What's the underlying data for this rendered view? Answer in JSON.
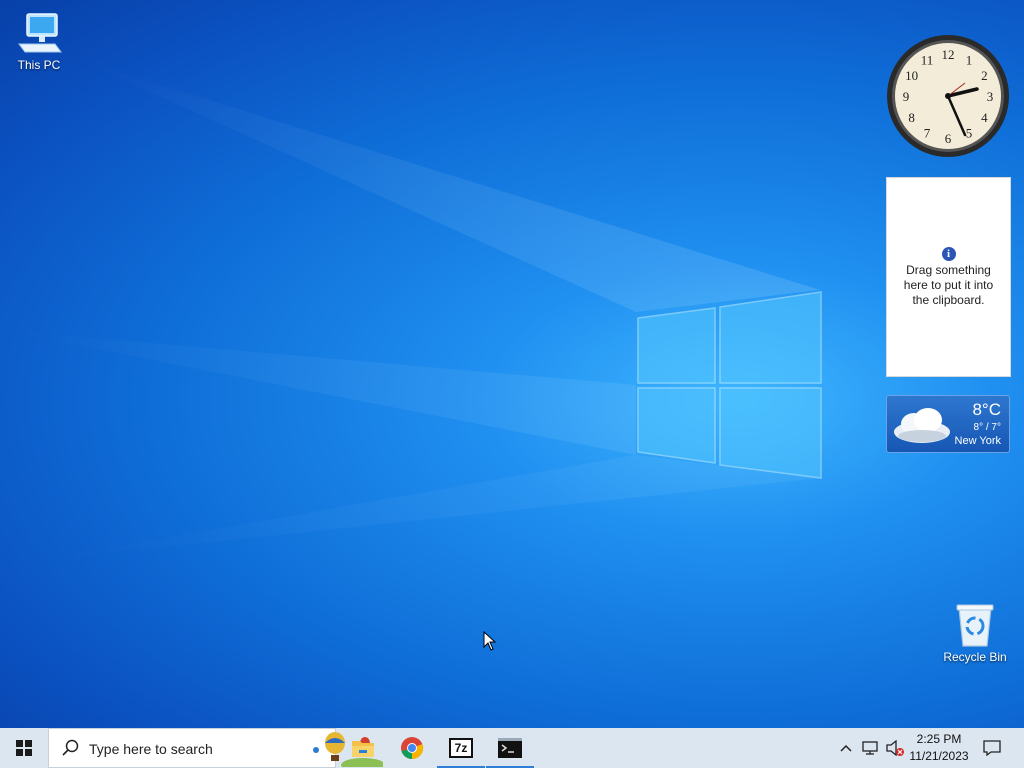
{
  "desktop": {
    "icons": [
      {
        "label": "This PC",
        "icon": "this-pc-icon"
      },
      {
        "label": "Recycle Bin",
        "icon": "recycle-bin-icon"
      }
    ]
  },
  "gadgets": {
    "clock": {
      "numbers": [
        "12",
        "1",
        "2",
        "3",
        "4",
        "5",
        "6",
        "7",
        "8",
        "9",
        "10",
        "11"
      ]
    },
    "clipboard": {
      "message": "Drag something here to put it into the clipboard."
    },
    "weather": {
      "temperature": "8°C",
      "range": "8° / 7°",
      "city": "New York"
    }
  },
  "taskbar": {
    "search_placeholder": "Type here to search",
    "apps": [
      {
        "name": "File Explorer",
        "icon": "folder-icon",
        "active": false
      },
      {
        "name": "Google Chrome",
        "icon": "chrome-icon",
        "active": false
      },
      {
        "name": "7-Zip",
        "icon": "7zip-icon",
        "label": "7z",
        "active": true
      },
      {
        "name": "Command Prompt",
        "icon": "cmd-icon",
        "active": true
      }
    ],
    "clock": {
      "time": "2:25 PM",
      "date": "11/21/2023"
    }
  },
  "colors": {
    "accent": "#0f6fd8",
    "taskbar": "#dce6f0",
    "active_indicator": "#2f7fd6"
  }
}
